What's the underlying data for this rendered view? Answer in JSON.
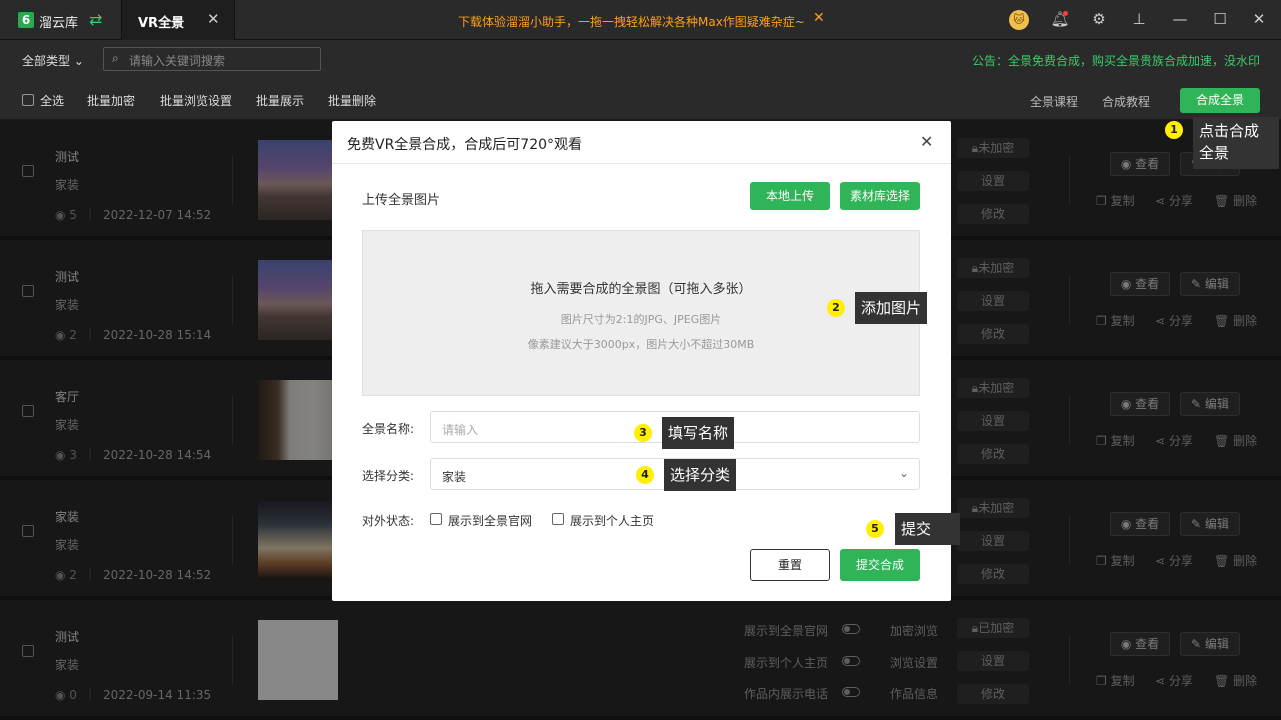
{
  "titlebar": {
    "logo": "6",
    "app_name": "溜云库",
    "tab_label": "VR全景",
    "tab_close": "✕",
    "promo": "下载体验溜溜小助手，一拖一拽轻松解决各种Max作图疑难杂症~",
    "promo_close": "✕",
    "avatar": "🐱"
  },
  "toolbar": {
    "filter_label": "全部类型 ⌄",
    "search_placeholder": "请输入关键词搜索",
    "notice": "公告：全景免费合成，购买全景贵族合成加速，没水印"
  },
  "actions": {
    "select_all": "全选",
    "batch_encrypt": "批量加密",
    "batch_browse": "批量浏览设置",
    "batch_show": "批量展示",
    "batch_delete": "批量删除",
    "course": "全景课程",
    "tutorial": "合成教程",
    "compose": "合成全景"
  },
  "rows": [
    {
      "title": "测试",
      "category": "家装",
      "views": "5",
      "date": "2022-12-07 14:52",
      "status": "未加密"
    },
    {
      "title": "测试",
      "category": "家装",
      "views": "2",
      "date": "2022-10-28 15:14",
      "status": "未加密"
    },
    {
      "title": "客厅",
      "category": "家装",
      "views": "3",
      "date": "2022-10-28 14:54",
      "status": "未加密"
    },
    {
      "title": "家装",
      "category": "家装",
      "views": "2",
      "date": "2022-10-28 14:52",
      "status": "未加密"
    },
    {
      "title": "测试",
      "category": "家装",
      "views": "0",
      "date": "2022-09-14 11:35",
      "status": "已加密"
    }
  ],
  "row_labels": {
    "settings": "设置",
    "modify": "修改",
    "view": "查看",
    "edit": "编辑",
    "copy": "复制",
    "share": "分享",
    "delete": "删除",
    "show_site": "展示到全景官网",
    "show_home": "展示到个人主页",
    "show_phone": "作品内展示电话",
    "encrypt_browse": "加密浏览",
    "browse_settings": "浏览设置",
    "work_info": "作品信息"
  },
  "modal": {
    "title": "免费VR全景合成，合成后可720°观看",
    "upload_label": "上传全景图片",
    "local_upload": "本地上传",
    "library_select": "素材库选择",
    "drop_title": "拖入需要合成的全景图（可拖入多张）",
    "drop_hint1": "图片尺寸为2:1的JPG、JPEG图片",
    "drop_hint2": "像素建议大于3000px，图片大小不超过30MB",
    "name_label": "全景名称:",
    "name_placeholder": "请输入",
    "category_label": "选择分类:",
    "category_value": "家装",
    "status_label": "对外状态:",
    "opt_site": "展示到全景官网",
    "opt_home": "展示到个人主页",
    "reset": "重置",
    "submit": "提交合成"
  },
  "steps": [
    {
      "num": "1",
      "text": "点击合成全景"
    },
    {
      "num": "2",
      "text": "添加图片"
    },
    {
      "num": "3",
      "text": "填写名称"
    },
    {
      "num": "4",
      "text": "选择分类"
    },
    {
      "num": "5",
      "text": "提交"
    }
  ],
  "colors": {
    "accent": "#2fb457",
    "promo": "#ff9f1a",
    "step": "#ffef00"
  }
}
